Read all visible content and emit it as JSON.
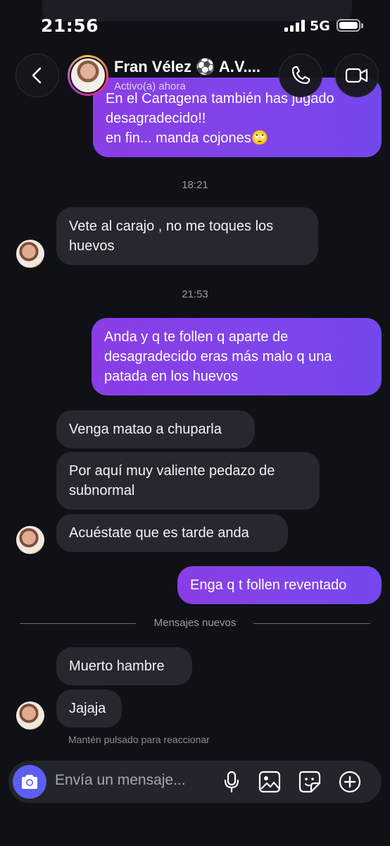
{
  "status_bar": {
    "time": "21:56",
    "network": "5G",
    "signal_bars": 4,
    "battery_level": 1.0
  },
  "header": {
    "contact_name": "Fran Vélez ⚽ A.V....",
    "contact_status": "Activo(a) ahora",
    "icons": {
      "back": "chevron-left-icon",
      "call": "phone-icon",
      "video": "video-camera-icon"
    }
  },
  "messages": [
    {
      "dir": "out",
      "text": "En el Cartagena también has jugado\ndesagradecido!!\nen fin... manda cojones🙄"
    },
    {
      "type": "timestamp",
      "text": "18:21"
    },
    {
      "dir": "in",
      "text": "Vete al carajo , no me toques los\nhuevos"
    },
    {
      "type": "timestamp",
      "text": "21:53"
    },
    {
      "dir": "out",
      "text": "Anda y q te follen q aparte de\ndesagradecido eras más malo q una\npatada en los huevos"
    },
    {
      "dir": "in",
      "text": "Venga matao a chuparla"
    },
    {
      "dir": "in",
      "text": "Por aquí muy valiente pedazo de\nsubnormal"
    },
    {
      "dir": "in",
      "text": "Acuéstate que es tarde anda"
    },
    {
      "dir": "out",
      "text": "Enga q t follen reventado"
    },
    {
      "type": "divider",
      "text": "Mensajes nuevos"
    },
    {
      "dir": "in",
      "text": "Muerto hambre"
    },
    {
      "dir": "in",
      "text": "Jajaja"
    }
  ],
  "hint": "Mantén pulsado para reaccionar",
  "composer": {
    "placeholder": "Envía un mensaje...",
    "icons": [
      "camera-icon",
      "microphone-icon",
      "image-icon",
      "sticker-icon",
      "plus-circle-icon"
    ]
  },
  "colors": {
    "background": "#0f1117",
    "incoming_bubble": "#262830",
    "outgoing_bubble_start": "#8a3de6",
    "outgoing_bubble_end": "#7447ec",
    "camera_button": "#5b5ff3"
  }
}
